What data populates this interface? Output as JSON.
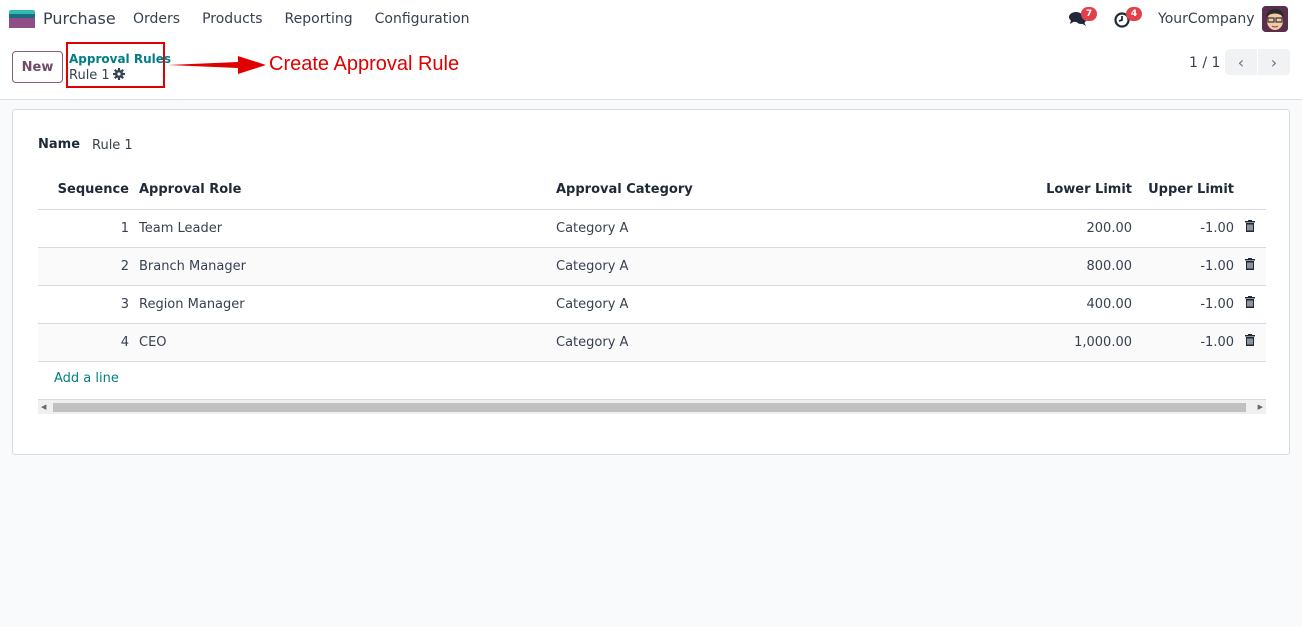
{
  "navbar": {
    "app_name": "Purchase",
    "menu": [
      "Orders",
      "Products",
      "Reporting",
      "Configuration"
    ],
    "messages_badge": "7",
    "activities_badge": "4",
    "company": "YourCompany",
    "icons": {
      "messages": "chat-bubbles-icon",
      "activities": "clock-icon",
      "avatar": "user-avatar"
    }
  },
  "control_panel": {
    "new_label": "New",
    "breadcrumb_parent": "Approval Rules",
    "breadcrumb_current": "Rule 1",
    "annotation": "Create Approval Rule",
    "pager": "1 / 1",
    "prev_label": "‹",
    "next_label": "›"
  },
  "form": {
    "name_label": "Name",
    "name_value": "Rule 1",
    "columns": [
      "Sequence",
      "Approval Role",
      "Approval Category",
      "Lower Limit",
      "Upper Limit"
    ],
    "rows": [
      {
        "sequence": "1",
        "role": "Team Leader",
        "category": "Category A",
        "lower": "200.00",
        "upper": "-1.00"
      },
      {
        "sequence": "2",
        "role": "Branch Manager",
        "category": "Category A",
        "lower": "800.00",
        "upper": "-1.00"
      },
      {
        "sequence": "3",
        "role": "Region Manager",
        "category": "Category A",
        "lower": "400.00",
        "upper": "-1.00"
      },
      {
        "sequence": "4",
        "role": "CEO",
        "category": "Category A",
        "lower": "1,000.00",
        "upper": "-1.00"
      }
    ],
    "add_line_label": "Add a line"
  },
  "colors": {
    "brand": "#714b67",
    "link": "#017e84",
    "badge": "#e0414a",
    "annotation": "#e00000"
  }
}
